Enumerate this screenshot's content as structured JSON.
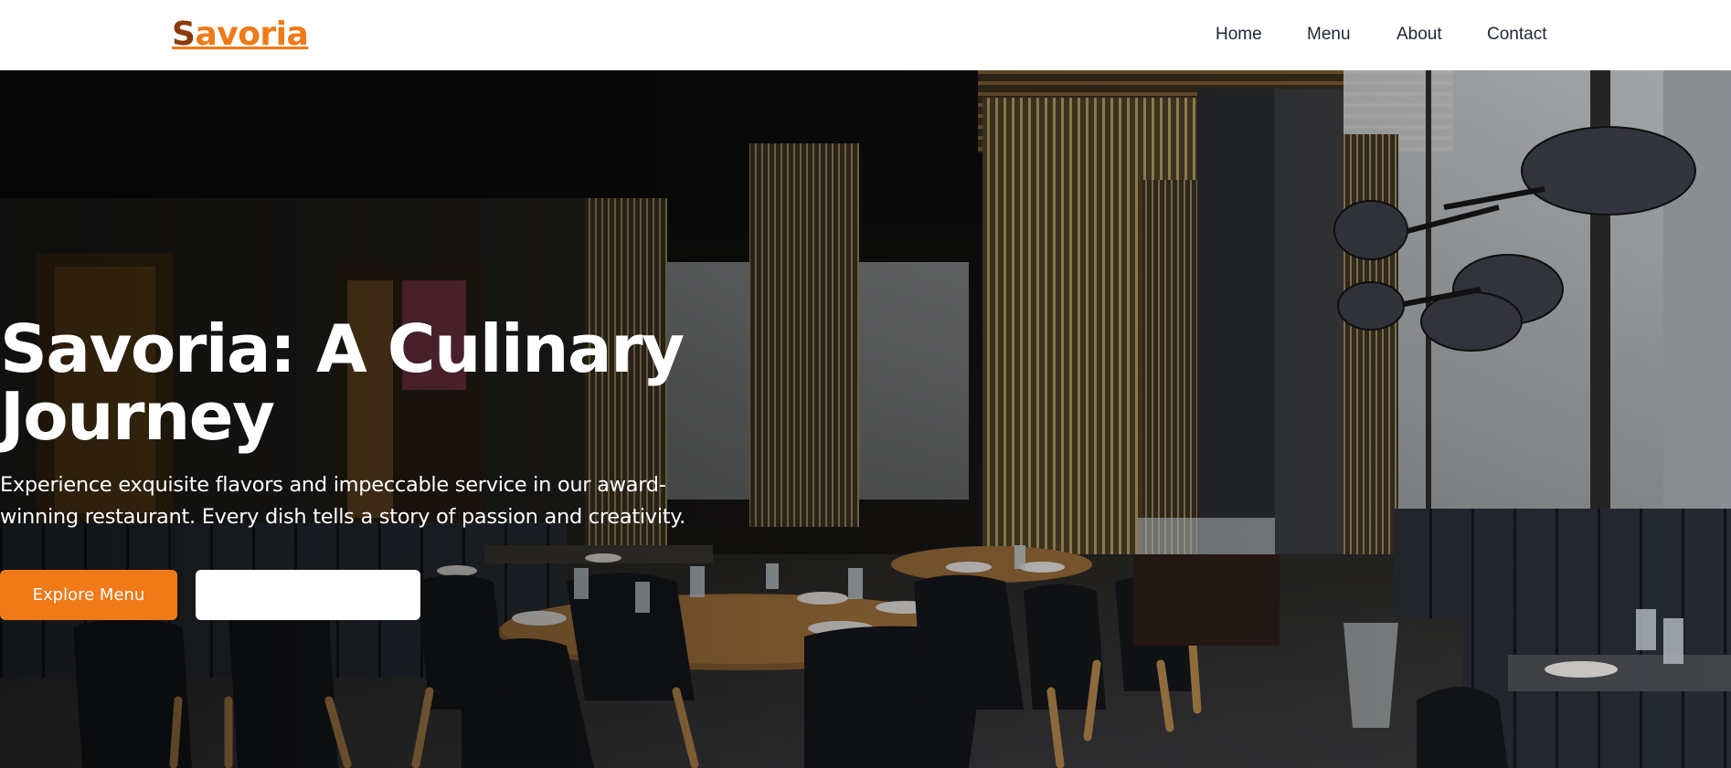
{
  "header": {
    "logo_first_letter": "S",
    "logo_rest": "avoria",
    "nav": [
      {
        "label": "Home"
      },
      {
        "label": "Menu"
      },
      {
        "label": "About"
      },
      {
        "label": "Contact"
      }
    ]
  },
  "hero": {
    "background_image": "restaurant-interior-photo",
    "title": "Savoria: A Culinary Journey",
    "subtitle": "Experience exquisite flavors and impeccable service in our award-winning restaurant. Every dish tells a story of passion and creativity.",
    "primary_button": "Explore Menu",
    "secondary_button": ""
  },
  "colors": {
    "accent": "#f07a17",
    "logo_dark": "#8a3a0b",
    "nav_text": "#1f2533",
    "hero_text": "#ffffff"
  }
}
